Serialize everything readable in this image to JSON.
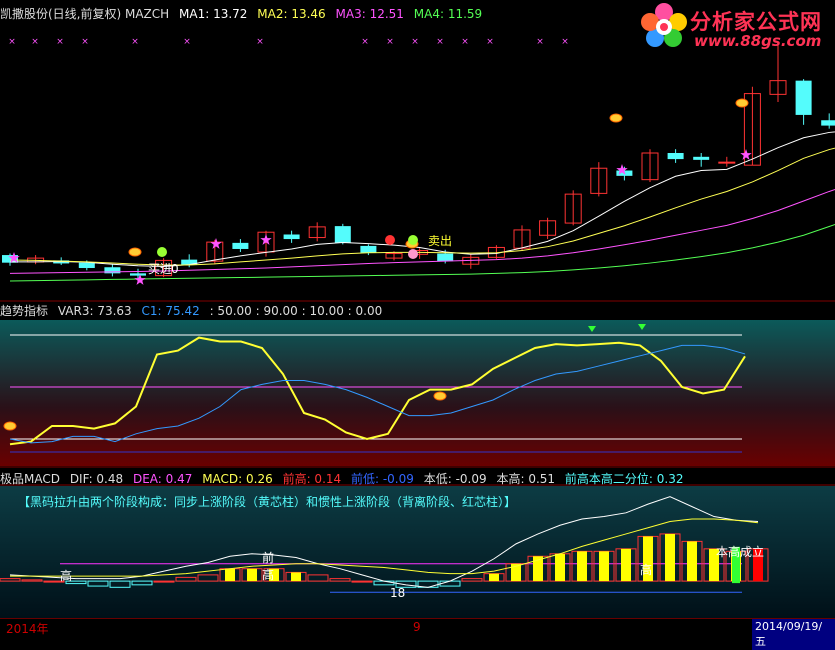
{
  "main_header": {
    "title": "凯撒股份(日线,前复权) MAZCH",
    "ma1": "MA1: 13.72",
    "ma2": "MA2: 13.46",
    "ma3": "MA3: 12.51",
    "ma4": "MA4: 11.59"
  },
  "trend_header": {
    "title": "趋势指标",
    "var3": "VAR3: 73.63",
    "c1": "C1: 75.42",
    "levels": ": 50.00 : 90.00 : 10.00 : 0.00"
  },
  "macd_header": {
    "title": "极品MACD",
    "dif": "DIF: 0.48",
    "dea": "DEA: 0.47",
    "macd": "MACD: 0.26",
    "prev_high": "前高: 0.14",
    "prev_low": "前低: -0.09",
    "this_low": "本低: -0.09",
    "this_high": "本高: 0.51",
    "q2": "前高本高二分位: 0.32"
  },
  "annotation": "【黑码拉升由两个阶段构成：同步上涨阶段（黄芯柱）和惯性上涨阶段（背离阶段、红芯柱）】",
  "labels": {
    "buy": "买进",
    "buy_value": "0",
    "sell": "卖出",
    "high_left": "高",
    "high_mid_top": "前",
    "high_mid": "高",
    "high_right": "高",
    "num18": "18",
    "this_high_label": "本高",
    "confirm_label": "成立"
  },
  "logo": {
    "text": "分析家公式网",
    "url": "www.88gs.com"
  },
  "bottom": {
    "year": "2014年",
    "tick": "9",
    "date": "2014/09/19/五"
  },
  "colors": {
    "up": "#ff3333",
    "down": "#54fcfc",
    "ma1": "#ffffff",
    "ma2": "#ffff54",
    "ma3": "#ff54ff",
    "ma4": "#54ff54",
    "star": "#ff54ff"
  },
  "chart_data": [
    {
      "type": "candlestick",
      "title": "凯撒股份(日线,前复权) MAZCH",
      "series": [
        {
          "name": "K",
          "ohlc": [
            [
              10.38,
              10.42,
              10.1,
              10.18
            ],
            [
              10.2,
              10.38,
              10.14,
              10.3
            ],
            [
              10.24,
              10.32,
              10.12,
              10.16
            ],
            [
              10.18,
              10.24,
              9.98,
              10.04
            ],
            [
              10.06,
              10.14,
              9.82,
              9.9
            ],
            [
              9.9,
              10.02,
              9.76,
              9.84
            ],
            [
              9.84,
              10.3,
              9.8,
              10.24
            ],
            [
              10.26,
              10.4,
              10.06,
              10.12
            ],
            [
              10.22,
              10.78,
              10.14,
              10.72
            ],
            [
              10.7,
              10.8,
              10.46,
              10.54
            ],
            [
              10.46,
              11.02,
              10.34,
              10.98
            ],
            [
              10.92,
              11.02,
              10.7,
              10.8
            ],
            [
              10.84,
              11.24,
              10.74,
              11.12
            ],
            [
              11.14,
              11.2,
              10.66,
              10.7
            ],
            [
              10.62,
              10.66,
              10.38,
              10.44
            ],
            [
              10.3,
              10.48,
              10.24,
              10.42
            ],
            [
              10.4,
              10.56,
              10.28,
              10.5
            ],
            [
              10.42,
              10.52,
              10.16,
              10.22
            ],
            [
              10.14,
              10.4,
              10.02,
              10.32
            ],
            [
              10.32,
              10.64,
              10.28,
              10.58
            ],
            [
              10.56,
              11.16,
              10.5,
              11.04
            ],
            [
              10.9,
              11.36,
              10.8,
              11.28
            ],
            [
              11.22,
              12.08,
              11.16,
              11.98
            ],
            [
              12.0,
              12.82,
              11.92,
              12.66
            ],
            [
              12.6,
              12.7,
              12.34,
              12.46
            ],
            [
              12.36,
              13.16,
              12.3,
              13.06
            ],
            [
              13.06,
              13.16,
              12.8,
              12.9
            ],
            [
              12.96,
              13.06,
              12.7,
              12.88
            ],
            [
              12.8,
              12.96,
              12.7,
              12.82
            ],
            [
              12.74,
              14.8,
              12.74,
              14.62
            ],
            [
              14.6,
              15.98,
              14.4,
              14.96
            ],
            [
              14.96,
              15.0,
              13.8,
              14.06
            ],
            [
              13.92,
              14.1,
              13.7,
              13.78
            ],
            [
              13.52,
              13.88,
              13.4,
              13.58
            ],
            [
              13.48,
              15.16,
              13.4,
              15.14
            ]
          ]
        },
        {
          "name": "MA1",
          "values": [
            10.2,
            10.2,
            10.21,
            10.19,
            10.14,
            10.1,
            10.08,
            10.13,
            10.25,
            10.36,
            10.45,
            10.54,
            10.66,
            10.71,
            10.68,
            10.64,
            10.58,
            10.46,
            10.4,
            10.42,
            10.57,
            10.74,
            11.02,
            11.4,
            11.79,
            12.15,
            12.45,
            12.6,
            12.63,
            12.9,
            13.2,
            13.46,
            13.6,
            13.66,
            13.72
          ]
        },
        {
          "name": "MA2",
          "values": [
            10.25,
            10.24,
            10.22,
            10.2,
            10.17,
            10.14,
            10.12,
            10.12,
            10.15,
            10.2,
            10.25,
            10.3,
            10.36,
            10.41,
            10.44,
            10.45,
            10.45,
            10.44,
            10.43,
            10.44,
            10.5,
            10.6,
            10.75,
            10.95,
            11.15,
            11.38,
            11.62,
            11.85,
            12.05,
            12.3,
            12.6,
            12.92,
            13.15,
            13.32,
            13.46
          ]
        },
        {
          "name": "MA3",
          "values": [
            9.9,
            9.91,
            9.92,
            9.93,
            9.94,
            9.95,
            9.96,
            9.98,
            10.0,
            10.02,
            10.04,
            10.07,
            10.1,
            10.13,
            10.16,
            10.18,
            10.2,
            10.22,
            10.24,
            10.26,
            10.3,
            10.36,
            10.44,
            10.54,
            10.65,
            10.77,
            10.9,
            11.03,
            11.16,
            11.34,
            11.55,
            11.8,
            12.05,
            12.28,
            12.51
          ]
        },
        {
          "name": "MA4",
          "values": [
            9.7,
            9.71,
            9.72,
            9.73,
            9.74,
            9.75,
            9.76,
            9.77,
            9.78,
            9.79,
            9.8,
            9.81,
            9.82,
            9.83,
            9.84,
            9.85,
            9.86,
            9.87,
            9.88,
            9.9,
            9.92,
            9.95,
            9.99,
            10.04,
            10.1,
            10.17,
            10.25,
            10.34,
            10.44,
            10.57,
            10.72,
            10.9,
            11.13,
            11.36,
            11.59
          ]
        }
      ],
      "ylim": [
        9.2,
        16.5
      ]
    },
    {
      "type": "line",
      "title": "趋势指标",
      "series": [
        {
          "name": "VAR3",
          "values": [
            6,
            8,
            20,
            20,
            18,
            22,
            35,
            75,
            78,
            88,
            85,
            85,
            80,
            60,
            30,
            25,
            15,
            10,
            14,
            40,
            48,
            48,
            52,
            64,
            72,
            80,
            83,
            82,
            83,
            84,
            82,
            70,
            50,
            45,
            48,
            73.63
          ]
        },
        {
          "name": "C1",
          "values": [
            10,
            7,
            8,
            12,
            12,
            8,
            14,
            18,
            20,
            26,
            35,
            48,
            52,
            55,
            55,
            52,
            48,
            42,
            35,
            28,
            28,
            30,
            35,
            40,
            48,
            55,
            60,
            62,
            66,
            70,
            74,
            78,
            82,
            82,
            80,
            75.42
          ]
        }
      ],
      "levels": [
        90,
        50,
        10,
        0
      ],
      "ylim": [
        0,
        100
      ]
    },
    {
      "type": "bar",
      "title": "极品MACD",
      "series": [
        {
          "name": "MACD",
          "values": [
            0.02,
            0.01,
            0.0,
            -0.02,
            -0.04,
            -0.05,
            -0.03,
            0.0,
            0.03,
            0.05,
            0.1,
            0.1,
            0.1,
            0.07,
            0.05,
            0.02,
            0.0,
            -0.03,
            -0.05,
            -0.05,
            -0.04,
            0.02,
            0.06,
            0.14,
            0.2,
            0.22,
            0.24,
            0.24,
            0.26,
            0.36,
            0.38,
            0.32,
            0.26,
            0.24,
            0.26
          ]
        },
        {
          "name": "DIF",
          "values": [
            0.05,
            0.04,
            0.03,
            0.02,
            0.02,
            0.02,
            0.04,
            0.08,
            0.12,
            0.15,
            0.2,
            0.22,
            0.21,
            0.19,
            0.14,
            0.1,
            0.05,
            0.0,
            -0.03,
            -0.05,
            0.0,
            0.08,
            0.18,
            0.3,
            0.38,
            0.45,
            0.5,
            0.52,
            0.55,
            0.62,
            0.68,
            0.6,
            0.52,
            0.49,
            0.48
          ]
        },
        {
          "name": "DEA",
          "values": [
            0.04,
            0.04,
            0.04,
            0.04,
            0.04,
            0.04,
            0.04,
            0.05,
            0.06,
            0.08,
            0.1,
            0.12,
            0.13,
            0.14,
            0.14,
            0.13,
            0.12,
            0.11,
            0.09,
            0.07,
            0.06,
            0.06,
            0.08,
            0.12,
            0.17,
            0.22,
            0.28,
            0.33,
            0.38,
            0.43,
            0.48,
            0.5,
            0.5,
            0.49,
            0.47
          ]
        }
      ],
      "ylim": [
        -0.12,
        0.75
      ]
    }
  ]
}
